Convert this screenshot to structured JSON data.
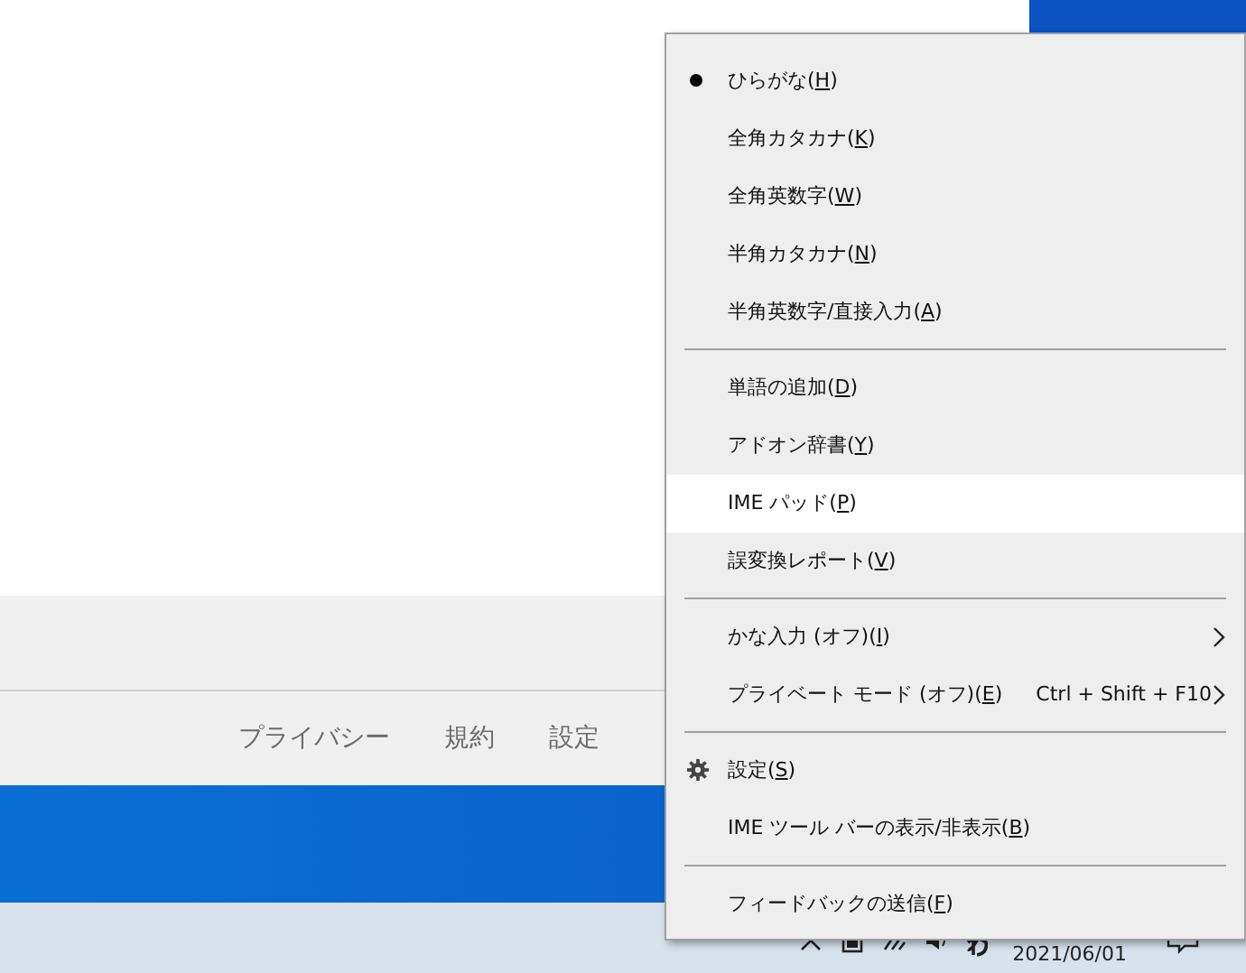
{
  "background_window": {
    "footer_links": [
      "プライバシー",
      "規約",
      "設定"
    ]
  },
  "taskbar": {
    "date": "2021/06/01"
  },
  "context_menu": {
    "groups": [
      {
        "items": [
          {
            "kind": "radio",
            "before": "ひらがな(",
            "key": "H",
            "after": ")",
            "selected": true,
            "hovered": false
          },
          {
            "kind": "radio",
            "before": "全角カタカナ(",
            "key": "K",
            "after": ")",
            "selected": false,
            "hovered": false
          },
          {
            "kind": "radio",
            "before": "全角英数字(",
            "key": "W",
            "after": ")",
            "selected": false,
            "hovered": false
          },
          {
            "kind": "radio",
            "before": "半角カタカナ(",
            "key": "N",
            "after": ")",
            "selected": false,
            "hovered": false
          },
          {
            "kind": "radio",
            "before": "半角英数字/直接入力(",
            "key": "A",
            "after": ")",
            "selected": false,
            "hovered": false
          }
        ]
      },
      {
        "items": [
          {
            "kind": "plain",
            "before": "単語の追加(",
            "key": "D",
            "after": ")",
            "hovered": false
          },
          {
            "kind": "plain",
            "before": "アドオン辞書(",
            "key": "Y",
            "after": ")",
            "hovered": false
          },
          {
            "kind": "plain",
            "before": "IME パッド(",
            "key": "P",
            "after": ")",
            "hovered": true
          },
          {
            "kind": "plain",
            "before": "誤変換レポート(",
            "key": "V",
            "after": ")",
            "hovered": false
          }
        ]
      },
      {
        "items": [
          {
            "kind": "submenu",
            "before": "かな入力 (オフ)(",
            "key": "I",
            "after": ")",
            "hovered": false
          },
          {
            "kind": "submenu",
            "before": "プライベート モード (オフ)(",
            "key": "E",
            "after": ")",
            "shortcut": "Ctrl + Shift + F10",
            "hovered": false
          }
        ]
      },
      {
        "items": [
          {
            "kind": "settings",
            "before": "設定(",
            "key": "S",
            "after": ")",
            "hovered": false
          },
          {
            "kind": "plain",
            "before": "IME ツール バーの表示/非表示(",
            "key": "B",
            "after": ")",
            "hovered": false
          }
        ]
      },
      {
        "items": [
          {
            "kind": "plain",
            "before": "フィードバックの送信(",
            "key": "F",
            "after": ")",
            "hovered": false
          }
        ]
      }
    ]
  }
}
